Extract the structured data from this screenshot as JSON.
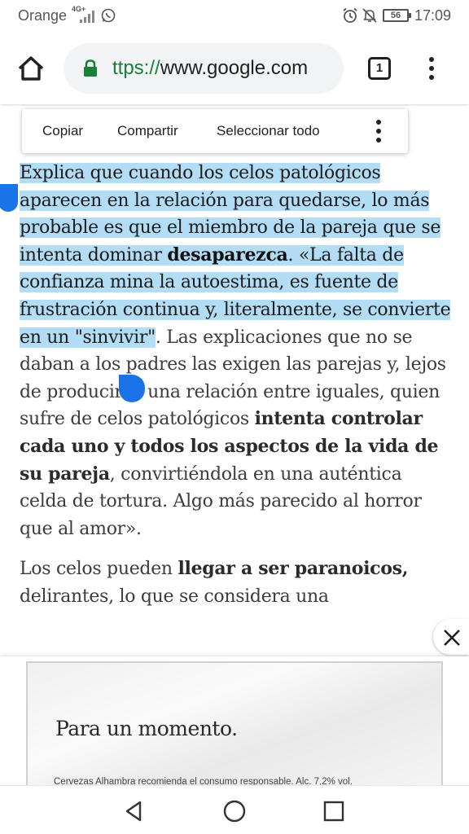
{
  "status_bar": {
    "carrier": "Orange",
    "network": "4G+",
    "battery": "56",
    "time": "17:09",
    "icons": [
      "signal-icon",
      "whatsapp-icon",
      "alarm-icon",
      "mute-icon",
      "battery-icon"
    ]
  },
  "toolbar": {
    "url_scheme": "ttps://",
    "url_host": "www.google.com",
    "tab_count": "1",
    "accent_color": "#188038",
    "icons": [
      "home-icon",
      "lock-icon",
      "tabs-icon",
      "more-vert-icon"
    ]
  },
  "context_menu": {
    "copy": "Copiar",
    "share": "Compartir",
    "select_all": "Seleccionar todo"
  },
  "article": {
    "p1_sel_a": "Explica que cuando los celos patológicos aparecen en la relación para quedarse, lo más probable es que el miembro de la pareja que se intenta dominar ",
    "p1_sel_bold": "desaparezca",
    "p1_sel_b": ". «La falta de confianza mina la autoestima, es fuente de frustración continua y, literalmente, se convierte en un \"sinvivir\"",
    "p1_rest_a": ". Las explicaciones que no se daban a los padres las exigen las parejas y, lejos de producirse una relación entre iguales, quien sufre de celos patológicos ",
    "p1_rest_bold": "intenta controlar cada uno y todos los aspectos de la vida de su pareja",
    "p1_rest_b": ", convirtiéndola en una auténtica celda de tortura. Algo más parecido al horror que al amor».",
    "p2_a": "Los celos pueden ",
    "p2_bold": "llegar a ser paranoicos,",
    "p2_b": " delirantes, lo que se considera una"
  },
  "selection_color": "#b3dcf5",
  "handle_color": "#1a73e8",
  "ad": {
    "headline": "Para un momento.",
    "disclaimer": "Cervezas Alhambra recomienda el consumo responsable. Alc. 7,2% vol."
  },
  "nav_bar": {
    "icons": [
      "back-icon",
      "home-circle-icon",
      "recents-icon"
    ]
  }
}
